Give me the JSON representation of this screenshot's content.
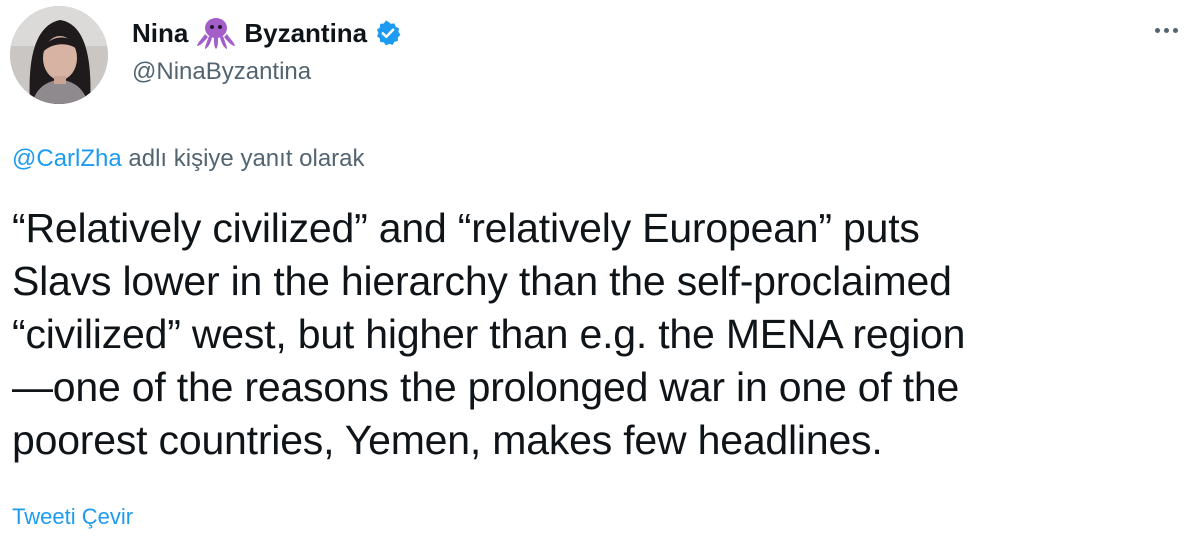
{
  "author": {
    "name_first": "Nina",
    "name_last": "Byzantina",
    "name_emoji": "octopus-icon",
    "verified_icon": "verified-badge-icon",
    "handle": "@NinaByzantina",
    "avatar": "avatar"
  },
  "menu": {
    "more_icon": "more-icon"
  },
  "reply": {
    "mention": "@CarlZha",
    "suffix": " adlı kişiye yanıt olarak"
  },
  "tweet": {
    "lines": [
      "“Relatively civilized” and “relatively European” puts",
      "Slavs lower in the hierarchy than the self-proclaimed",
      "“civilized” west, but higher than e.g. the MENA region",
      "—one of the reasons the prolonged war in one of the",
      "poorest countries, Yemen, makes few headlines."
    ]
  },
  "translate_label": "Tweeti Çevir",
  "colors": {
    "link": "#1d9bf0",
    "secondary": "#536471",
    "text": "#0f1419",
    "emoji": "#a35fc7"
  }
}
